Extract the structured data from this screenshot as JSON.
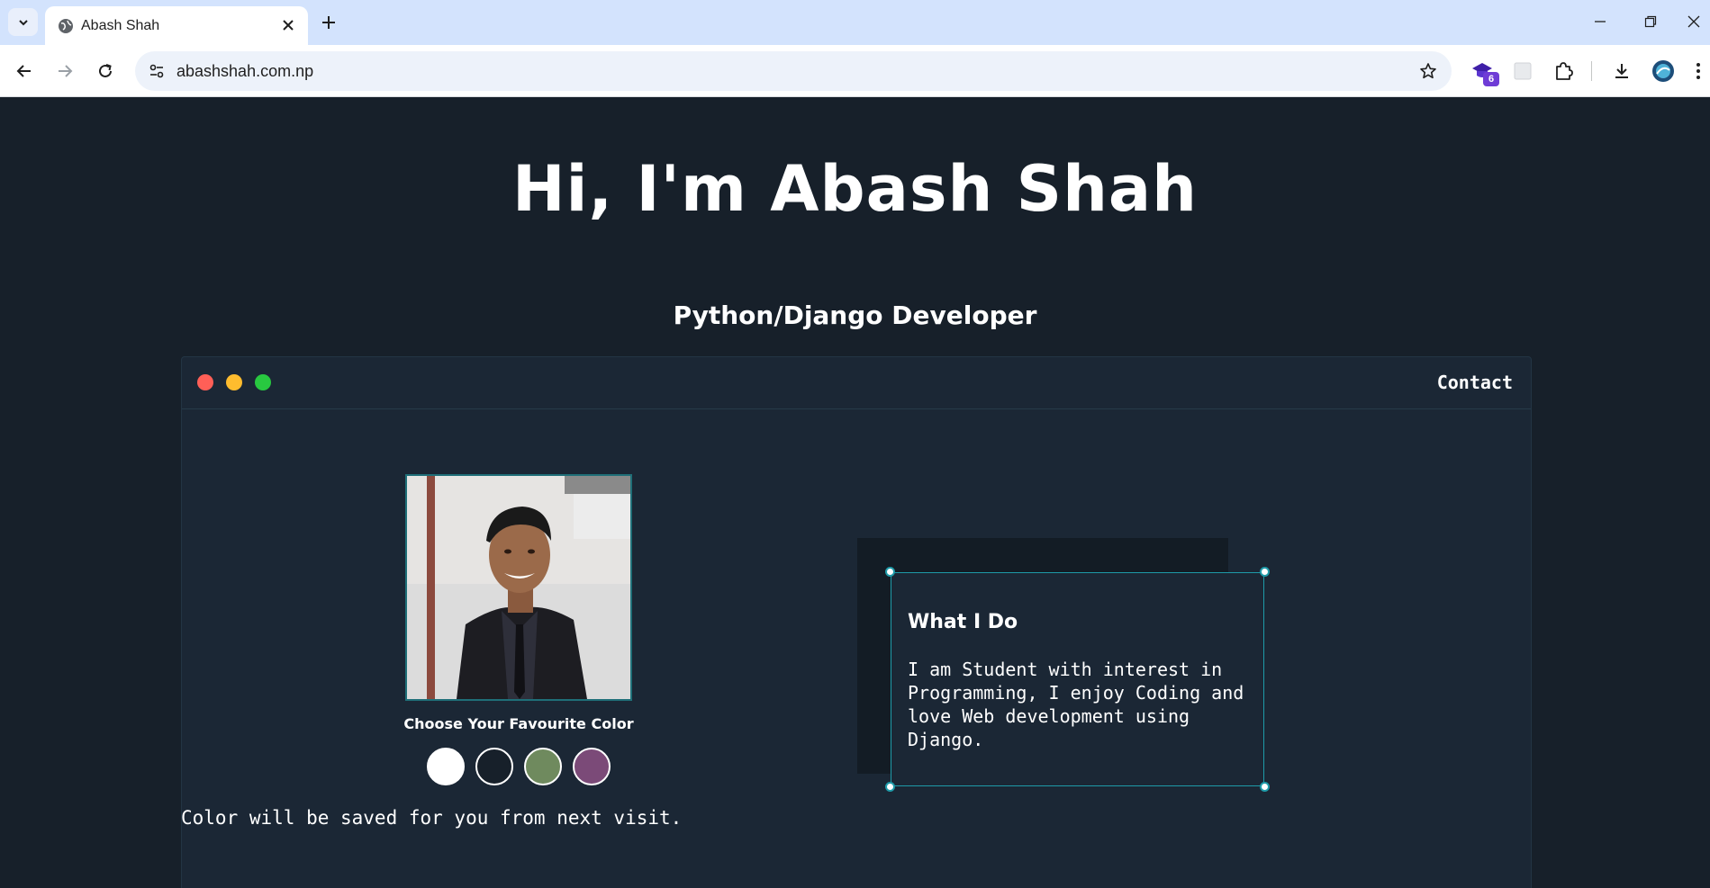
{
  "browser": {
    "tab_title": "Abash Shah",
    "url": "abashshah.com.np",
    "extension_badge": "6"
  },
  "page": {
    "title": "Hi, I'm Abash Shah",
    "subtitle": "Python/Django Developer",
    "window": {
      "contact_label": "Contact",
      "traffic_lights": [
        "#ff5f57",
        "#febc2e",
        "#28c840"
      ]
    },
    "profile": {
      "choose_color_label": "Choose Your Favourite Color",
      "swatches": [
        "#ffffff",
        "#17202a",
        "#6f8a5e",
        "#7b4a78"
      ],
      "note": "Color will be saved for you from next visit."
    },
    "card": {
      "title": "What I Do",
      "text": "I am Student with interest in Programming, I enjoy Coding and love Web development using Django."
    }
  },
  "colors": {
    "page_bg": "#17202a",
    "panel_bg": "#1b2735",
    "accent": "#1e9aa8"
  }
}
